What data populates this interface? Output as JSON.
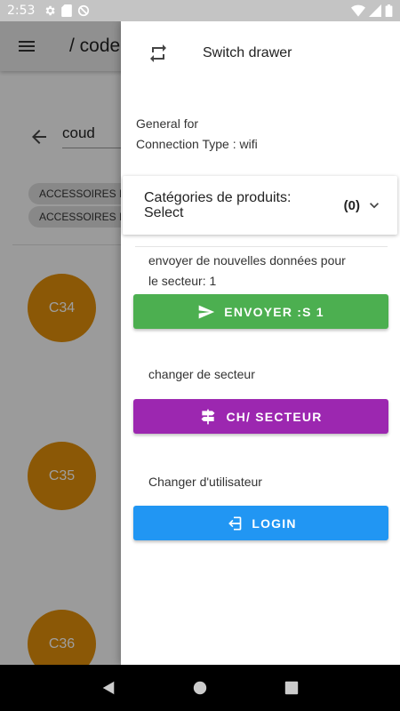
{
  "status_bar": {
    "time": "2:53",
    "left_icons": [
      "gear-icon",
      "sd-card-icon",
      "no-sync-icon"
    ],
    "right_icons": [
      "wifi-icon",
      "signal-icon",
      "battery-icon"
    ]
  },
  "background": {
    "appbar_title": "/ code",
    "search_query": "coud",
    "chips": [
      "ACCESSOIRES I",
      "ACCESSOIRES I"
    ],
    "avatars": [
      "C34",
      "C35",
      "C36"
    ]
  },
  "drawer": {
    "header_label": "Switch drawer",
    "general_for": "General for",
    "connection_type": "Connection Type : wifi",
    "category_title": "Catégories de produits:",
    "category_select": "Select",
    "category_count": "(0)",
    "send_note_line1": "envoyer de nouvelles données pour",
    "send_note_line2": "le secteur: 1",
    "send_button": "ENVOYER :S 1",
    "sector_note": "changer de secteur",
    "sector_button": "CH/ SECTEUR",
    "user_note": "Changer d'utilisateur",
    "login_button": "LOGIN"
  },
  "colors": {
    "send": "#4caf50",
    "sector": "#9c27b0",
    "login": "#2196f3",
    "avatar": "#e08e0b"
  }
}
